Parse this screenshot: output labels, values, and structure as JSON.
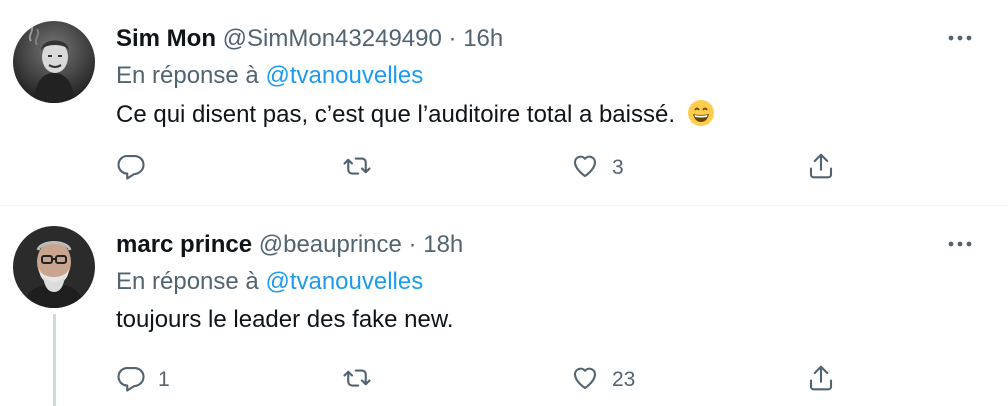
{
  "tweets": [
    {
      "name": "Sim Mon",
      "handle": "@SimMon43249490",
      "separator": "·",
      "time": "16h",
      "reply_prefix": "En réponse à",
      "reply_to": "@tvanouvelles",
      "text": "Ce qui disent pas, c’est que l’auditoire total a baissé.",
      "emoji": "grinning-face-with-smiling-eyes",
      "reply_count": "",
      "retweet_count": "",
      "like_count": "3",
      "avatar": "joker-smoking-avatar"
    },
    {
      "name": "marc prince",
      "handle": "@beauprince",
      "separator": "·",
      "time": "18h",
      "reply_prefix": "En réponse à",
      "reply_to": "@tvanouvelles",
      "text": "toujours le leader des fake new.",
      "reply_count": "1",
      "retweet_count": "",
      "like_count": "23",
      "avatar": "bearded-man-glasses-avatar"
    }
  ],
  "colors": {
    "text": "#0f1419",
    "secondary": "#536471",
    "link": "#1d9bf0",
    "divider": "#eff3f4",
    "thread": "#cfd9de"
  }
}
